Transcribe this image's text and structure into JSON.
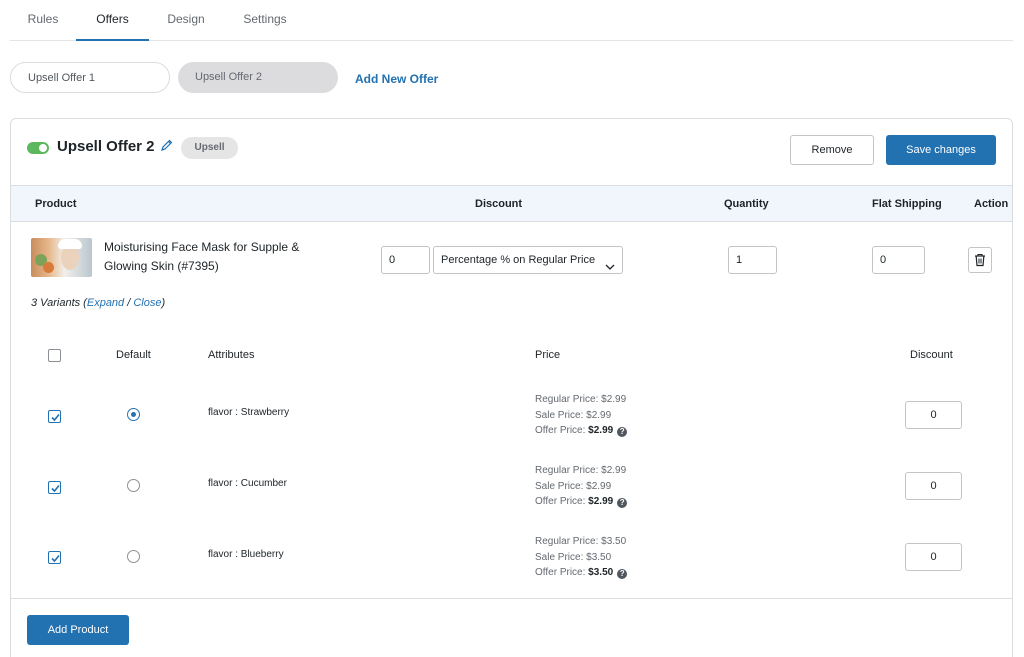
{
  "tabs": [
    {
      "label": "Rules",
      "active": false
    },
    {
      "label": "Offers",
      "active": true
    },
    {
      "label": "Design",
      "active": false
    },
    {
      "label": "Settings",
      "active": false
    }
  ],
  "offers": [
    {
      "label": "Upsell Offer 1",
      "selected": false
    },
    {
      "label": "Upsell Offer 2",
      "selected": true
    }
  ],
  "add_offer_label": "Add New Offer",
  "offer": {
    "enabled": true,
    "title": "Upsell Offer 2",
    "type_badge": "Upsell",
    "remove_label": "Remove",
    "save_label": "Save changes"
  },
  "table": {
    "headers": {
      "product": "Product",
      "discount": "Discount",
      "quantity": "Quantity",
      "flat_shipping": "Flat Shipping",
      "action": "Action"
    }
  },
  "product": {
    "name": "Moisturising Face Mask for Supple & Glowing Skin (#7395)",
    "discount_value": "0",
    "discount_type": "Percentage % on Regular Price",
    "quantity": "1",
    "flat_shipping": "0",
    "variants_count_label": "3 Variants",
    "expand_label": "Expand",
    "separator": "/",
    "close_label": "Close"
  },
  "variant_table": {
    "headers": {
      "default": "Default",
      "attributes": "Attributes",
      "price": "Price",
      "discount": "Discount"
    },
    "rows": [
      {
        "checked": true,
        "default": true,
        "attribute": "flavor : Strawberry",
        "regular": "Regular Price: $2.99",
        "sale": "Sale Price: $2.99",
        "offer_label": "Offer Price:",
        "offer_value": "$2.99",
        "discount": "0"
      },
      {
        "checked": true,
        "default": false,
        "attribute": "flavor : Cucumber",
        "regular": "Regular Price: $2.99",
        "sale": "Sale Price: $2.99",
        "offer_label": "Offer Price:",
        "offer_value": "$2.99",
        "discount": "0"
      },
      {
        "checked": true,
        "default": false,
        "attribute": "flavor : Blueberry",
        "regular": "Regular Price: $3.50",
        "sale": "Sale Price: $3.50",
        "offer_label": "Offer Price:",
        "offer_value": "$3.50",
        "discount": "0"
      }
    ]
  },
  "add_product_label": "Add Product",
  "colors": {
    "accent": "#2271b1",
    "toggle_on": "#5cb85c",
    "header_bg": "#f0f6fc"
  },
  "icons": [
    "pencil-icon",
    "chevron-down-icon",
    "trash-icon",
    "help-icon",
    "check-icon"
  ]
}
